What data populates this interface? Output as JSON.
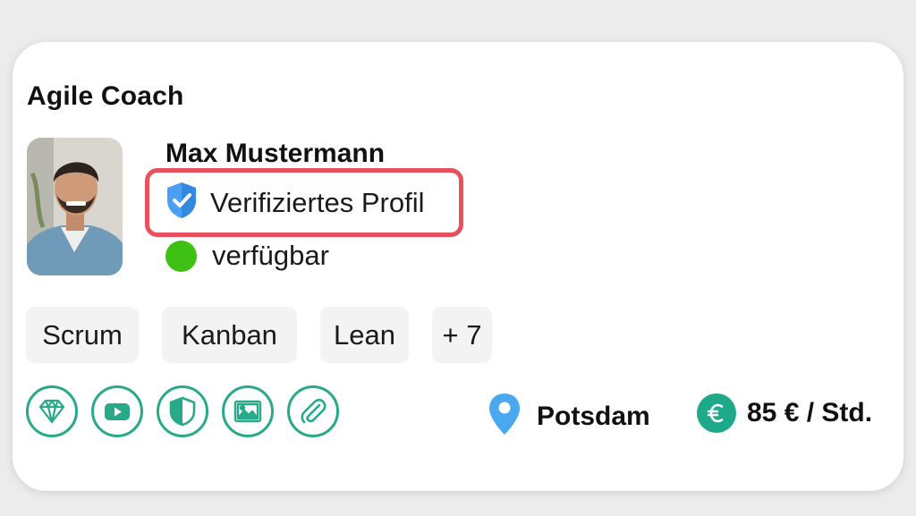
{
  "card": {
    "title": "Agile Coach",
    "name": "Max Mustermann",
    "verified_label": "Verifiziertes Profil",
    "availability_label": "verfügbar",
    "tags": [
      "Scrum",
      "Kanban",
      "Lean",
      "+ 7"
    ],
    "feature_icons": [
      "diamond-icon",
      "youtube-icon",
      "shield-icon",
      "image-icon",
      "paperclip-icon"
    ],
    "location": "Potsdam",
    "rate": "85 € / Std."
  },
  "colors": {
    "accent_green": "#28a98a",
    "available_dot": "#3fc014",
    "highlight_border": "#e8505b",
    "verified_blue": "#4a9ff5",
    "location_pin": "#4aa8f0"
  }
}
